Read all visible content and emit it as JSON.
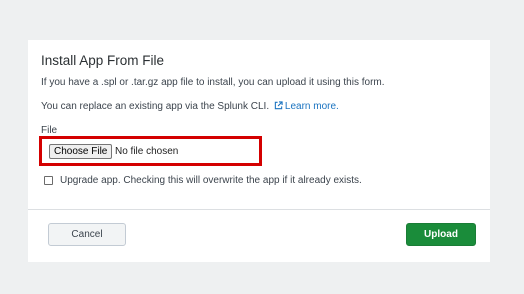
{
  "modal": {
    "title": "Install App From File",
    "line1": "If you have a .spl or .tar.gz app file to install, you can upload it using this form.",
    "line2_text": "You can replace an existing app via the Splunk CLI.",
    "learn_more": "Learn more.",
    "file_label": "File",
    "choose_file_label": "Choose File",
    "no_file_text": "No file chosen",
    "upgrade_label": "Upgrade app. Checking this will overwrite the app if it already exists.",
    "cancel_label": "Cancel",
    "upload_label": "Upload"
  },
  "colors": {
    "link": "#1a73c0",
    "upload_bg": "#1a8c3a",
    "highlight": "#d40000"
  },
  "icons": {
    "learn_more": "external-link-icon"
  }
}
